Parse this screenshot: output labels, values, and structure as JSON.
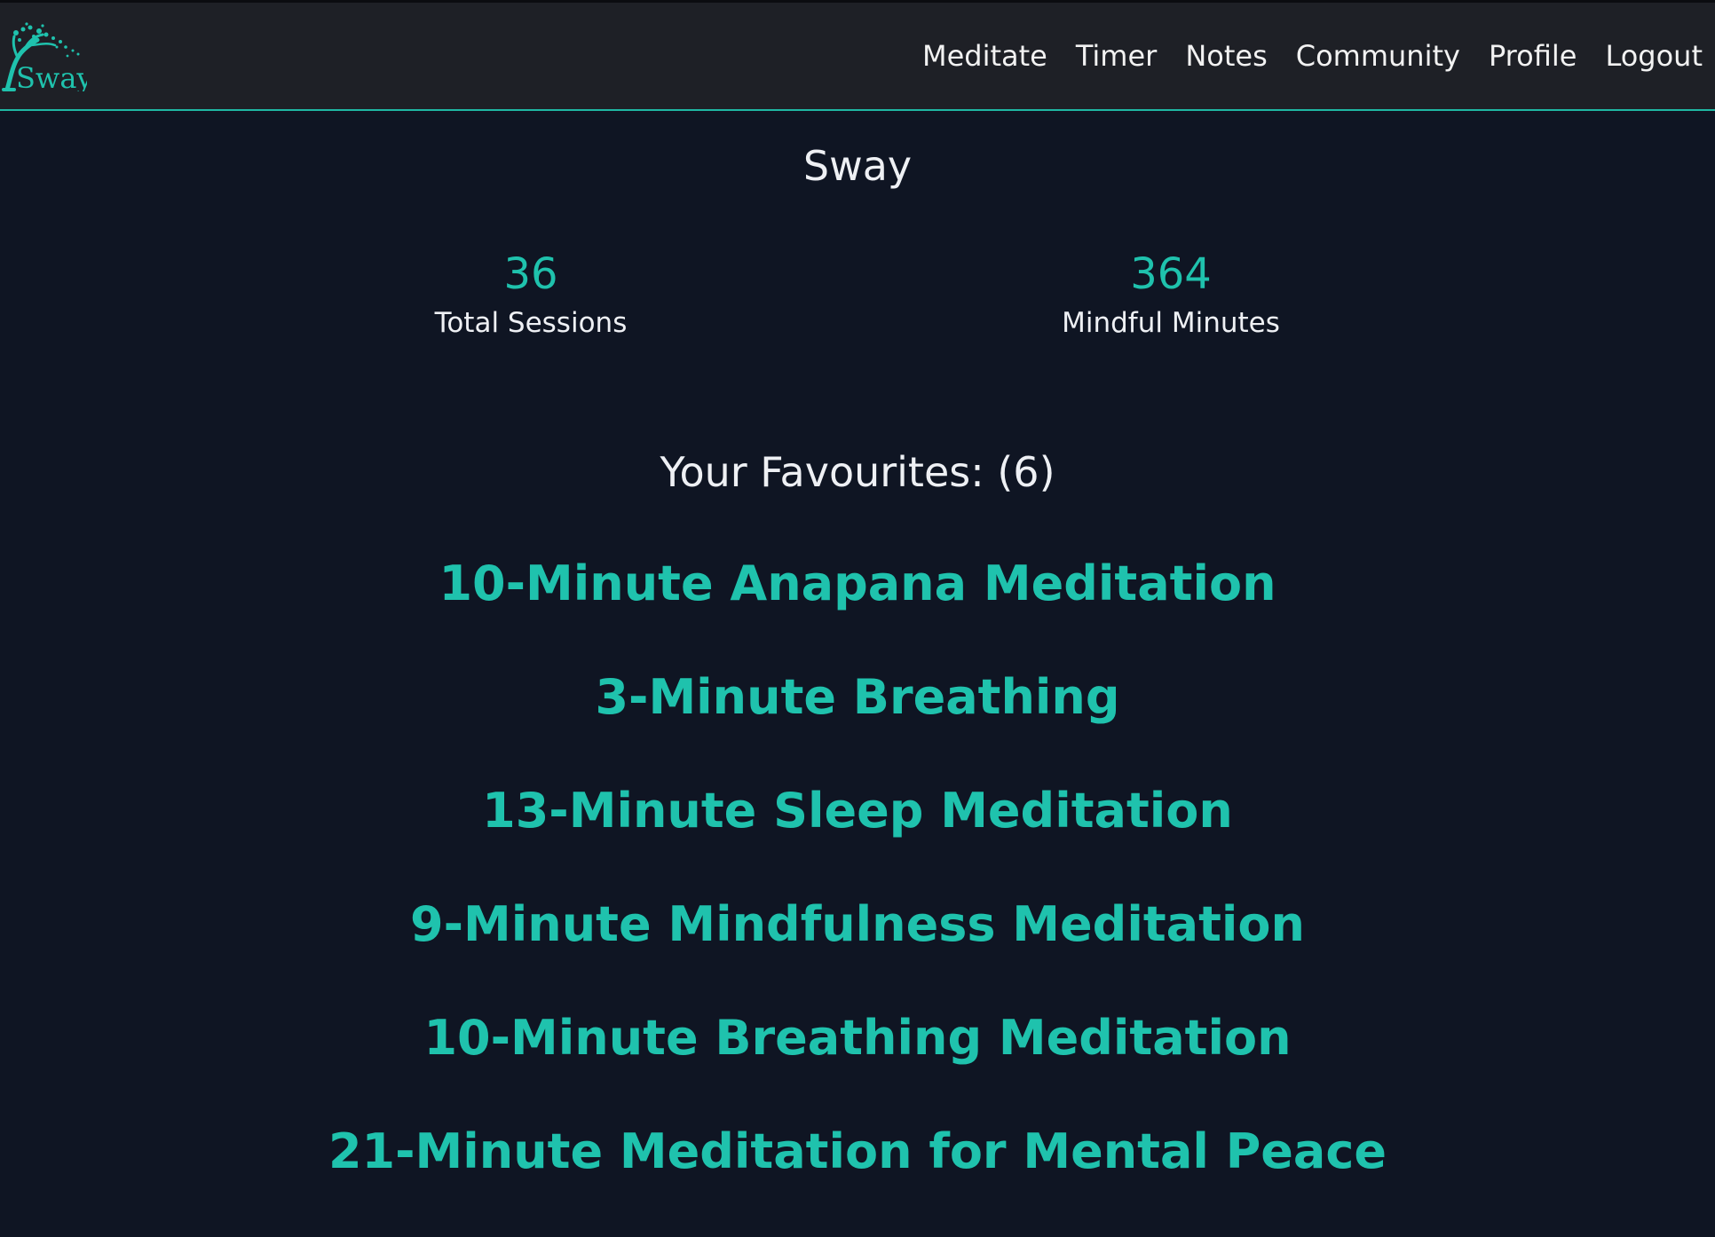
{
  "nav": {
    "logo_text": "Sway",
    "links": [
      "Meditate",
      "Timer",
      "Notes",
      "Community",
      "Profile",
      "Logout"
    ]
  },
  "page": {
    "title": "Sway"
  },
  "stats": {
    "total_sessions": {
      "value": "36",
      "label": "Total Sessions"
    },
    "mindful_minutes": {
      "value": "364",
      "label": "Mindful Minutes"
    }
  },
  "favourites": {
    "heading": "Your Favourites: (6)",
    "items": [
      "10-Minute Anapana Meditation",
      "3-Minute Breathing",
      "13-Minute Sleep Meditation",
      "9-Minute Mindfulness Meditation",
      "10-Minute Breathing Meditation",
      "21-Minute Meditation for Mental Peace"
    ]
  },
  "colors": {
    "background": "#0f1523",
    "navbar": "#1e2026",
    "accent": "#1fc2ad",
    "text": "#eef0f4"
  }
}
